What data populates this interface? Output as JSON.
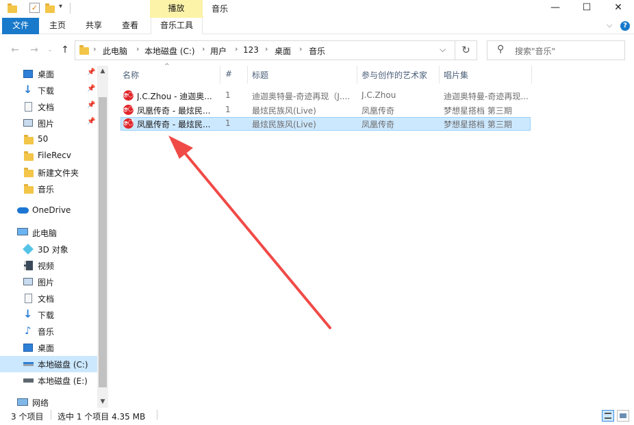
{
  "window": {
    "title": "音乐",
    "context_tab": "播放",
    "controls": {
      "minimize": "—",
      "maximize": "☐",
      "close": "✕"
    }
  },
  "ribbon": {
    "tabs": [
      "文件",
      "主页",
      "共享",
      "查看",
      "音乐工具"
    ],
    "active_tab": "文件",
    "file_tab_color": "#1979ca",
    "context_color": "#fcf3a9"
  },
  "address": {
    "breadcrumbs": [
      "此电脑",
      "本地磁盘 (C:)",
      "用户",
      "123",
      "桌面",
      "音乐"
    ]
  },
  "search": {
    "placeholder": "搜索\"音乐\""
  },
  "sidebar": {
    "quick_access": [
      {
        "label": "桌面",
        "icon": "desktop-icon",
        "pinned": true
      },
      {
        "label": "下载",
        "icon": "download-icon",
        "pinned": true
      },
      {
        "label": "文档",
        "icon": "document-icon",
        "pinned": true
      },
      {
        "label": "图片",
        "icon": "picture-icon",
        "pinned": true
      },
      {
        "label": "50",
        "icon": "folder-icon",
        "pinned": false
      },
      {
        "label": "FileRecv",
        "icon": "folder-icon",
        "pinned": false
      },
      {
        "label": "新建文件夹",
        "icon": "folder-icon",
        "pinned": false
      },
      {
        "label": "音乐",
        "icon": "folder-icon",
        "pinned": false
      }
    ],
    "onedrive": "OneDrive",
    "this_pc": "此电脑",
    "pc_items": [
      {
        "label": "3D 对象",
        "icon": "3d-objects-icon"
      },
      {
        "label": "视频",
        "icon": "video-icon"
      },
      {
        "label": "图片",
        "icon": "picture-icon"
      },
      {
        "label": "文档",
        "icon": "document-icon"
      },
      {
        "label": "下载",
        "icon": "download-icon"
      },
      {
        "label": "音乐",
        "icon": "music-icon"
      },
      {
        "label": "桌面",
        "icon": "desktop-icon"
      },
      {
        "label": "本地磁盘 (C:)",
        "icon": "drive-c-icon",
        "active": true
      },
      {
        "label": "本地磁盘 (E:)",
        "icon": "drive-e-icon"
      }
    ],
    "network": "网络"
  },
  "file_list": {
    "columns": [
      "名称",
      "#",
      "标题",
      "参与创作的艺术家",
      "唱片集"
    ],
    "rows": [
      {
        "name": "J.C.Zhou - 迪迦奥...",
        "num": "1",
        "title": "迪迦奥特曼-奇迹再现（J....",
        "artist": "J.C.Zhou",
        "album": "迪迦奥特曼-奇迹再现...",
        "selected": false
      },
      {
        "name": "凤凰传奇 - 最炫民...",
        "num": "1",
        "title": "最炫民族风(Live)",
        "artist": "凤凰传奇",
        "album": "梦想星搭档 第三期",
        "selected": false
      },
      {
        "name": "凤凰传奇 - 最炫民...",
        "num": "1",
        "title": "最炫民族风(Live)",
        "artist": "凤凰传奇",
        "album": "梦想星搭档 第三期",
        "selected": true
      }
    ]
  },
  "status": {
    "count": "3 个项目",
    "selection": "选中 1 个项目  4.35 MB"
  },
  "annotation": {
    "arrow_color": "#f04a47"
  }
}
